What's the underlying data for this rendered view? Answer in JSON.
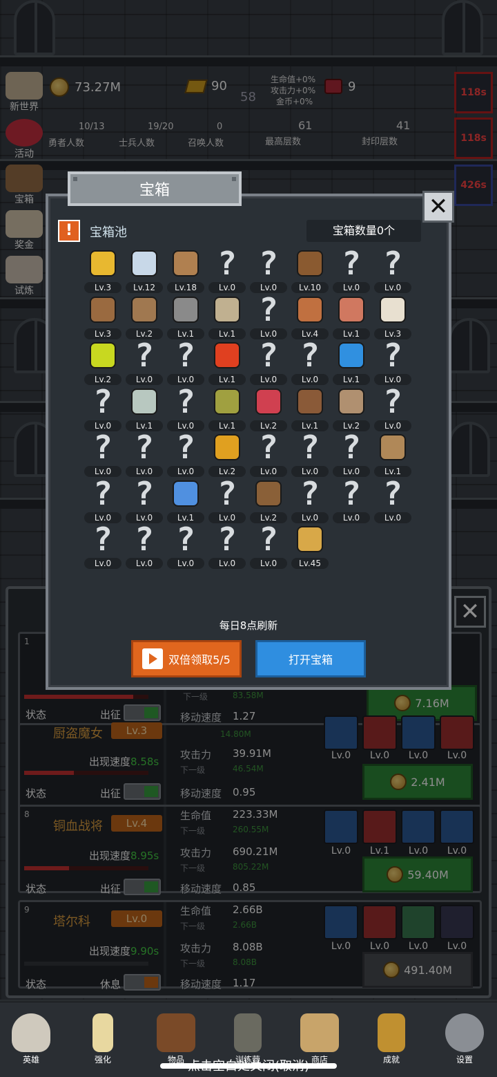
{
  "top": {
    "gold": "73.27M",
    "gem": "90",
    "mid_num": "58",
    "buffs": [
      "生命值+0%",
      "攻击力+0%",
      "金币+0%"
    ],
    "ruby": "9",
    "stats": [
      {
        "value": "10/13",
        "label": "勇者人数"
      },
      {
        "value": "19/20",
        "label": "士兵人数"
      },
      {
        "value": "0",
        "label": "召唤人数"
      },
      {
        "value": "61",
        "label": "最高层数"
      },
      {
        "value": "41",
        "label": "封印层数"
      }
    ]
  },
  "side": [
    "新世界",
    "活动",
    "宝箱",
    "奖金",
    "试炼"
  ],
  "timers": [
    "118s",
    "118s",
    "426s"
  ],
  "dialog": {
    "title": "宝箱",
    "pool_title": "宝箱池",
    "count": "宝箱数量0个",
    "refresh": "每日8点刷新",
    "double_btn": "双倍领取5/5",
    "open_btn": "打开宝箱",
    "items": [
      {
        "icon": "crown",
        "lv": "Lv.3"
      },
      {
        "icon": "diamond",
        "lv": "Lv.12"
      },
      {
        "icon": "sword",
        "lv": "Lv.18"
      },
      {
        "icon": "unknown",
        "lv": "Lv.0"
      },
      {
        "icon": "unknown",
        "lv": "Lv.0"
      },
      {
        "icon": "leather-armor",
        "lv": "Lv.10"
      },
      {
        "icon": "unknown",
        "lv": "Lv.0"
      },
      {
        "icon": "unknown",
        "lv": "Lv.0"
      },
      {
        "icon": "helmet",
        "lv": "Lv.3"
      },
      {
        "icon": "dagger",
        "lv": "Lv.2"
      },
      {
        "icon": "knight-helmet",
        "lv": "Lv.1"
      },
      {
        "icon": "hammer",
        "lv": "Lv.1"
      },
      {
        "icon": "unknown",
        "lv": "Lv.0"
      },
      {
        "icon": "ham",
        "lv": "Lv.4"
      },
      {
        "icon": "steak",
        "lv": "Lv.1"
      },
      {
        "icon": "rice",
        "lv": "Lv.3"
      },
      {
        "icon": "yellow-potion",
        "lv": "Lv.2"
      },
      {
        "icon": "unknown",
        "lv": "Lv.0"
      },
      {
        "icon": "unknown",
        "lv": "Lv.0"
      },
      {
        "icon": "red-potion",
        "lv": "Lv.1"
      },
      {
        "icon": "unknown",
        "lv": "Lv.0"
      },
      {
        "icon": "unknown",
        "lv": "Lv.0"
      },
      {
        "icon": "blue-potion",
        "lv": "Lv.1"
      },
      {
        "icon": "unknown",
        "lv": "Lv.0"
      },
      {
        "icon": "unknown",
        "lv": "Lv.0"
      },
      {
        "icon": "empty-bottle",
        "lv": "Lv.1"
      },
      {
        "icon": "unknown",
        "lv": "Lv.0"
      },
      {
        "icon": "olive-bottle",
        "lv": "Lv.1"
      },
      {
        "icon": "red-bottle",
        "lv": "Lv.2"
      },
      {
        "icon": "boot",
        "lv": "Lv.1"
      },
      {
        "icon": "shoe",
        "lv": "Lv.2"
      },
      {
        "icon": "unknown",
        "lv": "Lv.0"
      },
      {
        "icon": "unknown",
        "lv": "Lv.0"
      },
      {
        "icon": "unknown",
        "lv": "Lv.0"
      },
      {
        "icon": "unknown",
        "lv": "Lv.0"
      },
      {
        "icon": "torch",
        "lv": "Lv.2"
      },
      {
        "icon": "unknown",
        "lv": "Lv.0"
      },
      {
        "icon": "unknown",
        "lv": "Lv.0"
      },
      {
        "icon": "unknown",
        "lv": "Lv.0"
      },
      {
        "icon": "staff",
        "lv": "Lv.1"
      },
      {
        "icon": "unknown",
        "lv": "Lv.0"
      },
      {
        "icon": "unknown",
        "lv": "Lv.0"
      },
      {
        "icon": "blue-wand",
        "lv": "Lv.1"
      },
      {
        "icon": "unknown",
        "lv": "Lv.0"
      },
      {
        "icon": "backpack",
        "lv": "Lv.2"
      },
      {
        "icon": "unknown",
        "lv": "Lv.0"
      },
      {
        "icon": "unknown",
        "lv": "Lv.0"
      },
      {
        "icon": "unknown",
        "lv": "Lv.0"
      },
      {
        "icon": "unknown",
        "lv": "Lv.0"
      },
      {
        "icon": "unknown",
        "lv": "Lv.0"
      },
      {
        "icon": "unknown",
        "lv": "Lv.0"
      },
      {
        "icon": "unknown",
        "lv": "Lv.0"
      },
      {
        "icon": "unknown",
        "lv": "Lv.0"
      },
      {
        "icon": "beer",
        "lv": "Lv.45"
      }
    ]
  },
  "heroes": {
    "card1": {
      "num": "1",
      "sub": "下一级",
      "sub_val": "83.58M",
      "status": "状态",
      "deploy": "出征",
      "speed_label": "移动速度",
      "speed": "1.27",
      "btn": "7.16M"
    },
    "card2": {
      "name": "厨盗魔女",
      "lv": "Lv.3",
      "sub_val1": "14.80M",
      "appear_label": "出现速度",
      "appear": "8.58s",
      "atk_label": "攻击力",
      "atk": "39.91M",
      "sub": "下一级",
      "atk_next": "46.54M",
      "status": "状态",
      "deploy": "出征",
      "speed_label": "移动速度",
      "speed": "0.95",
      "skills": [
        "Lv.0",
        "Lv.0",
        "Lv.0",
        "Lv.0"
      ],
      "btn": "2.41M"
    },
    "card3": {
      "num": "8",
      "name": "铜血战将",
      "lv": "Lv.4",
      "hp_label": "生命值",
      "hp": "223.33M",
      "sub": "下一级",
      "hp_next": "260.55M",
      "appear_label": "出现速度",
      "appear": "8.95s",
      "atk_label": "攻击力",
      "atk": "690.21M",
      "atk_next": "805.22M",
      "status": "状态",
      "deploy": "出征",
      "speed_label": "移动速度",
      "speed": "0.85",
      "skills": [
        "Lv.0",
        "Lv.1",
        "Lv.0",
        "Lv.0"
      ],
      "btn": "59.40M"
    },
    "card4": {
      "num": "9",
      "name": "塔尔科",
      "lv": "Lv.0",
      "hp_label": "生命值",
      "hp": "2.66B",
      "sub": "下一级",
      "hp_next": "2.66B",
      "appear_label": "出现速度",
      "appear": "9.90s",
      "atk_label": "攻击力",
      "atk": "8.08B",
      "atk_next": "8.08B",
      "status": "状态",
      "deploy": "休息",
      "speed_label": "移动速度",
      "speed": "1.17",
      "skills": [
        "Lv.0",
        "Lv.0",
        "Lv.0",
        "Lv.0"
      ],
      "btn": "491.40M"
    }
  },
  "nav": [
    "英雄",
    "强化",
    "物品",
    "训练营",
    "商店",
    "成就",
    "设置"
  ],
  "close_hint": "点击空白处关闭(取消)"
}
